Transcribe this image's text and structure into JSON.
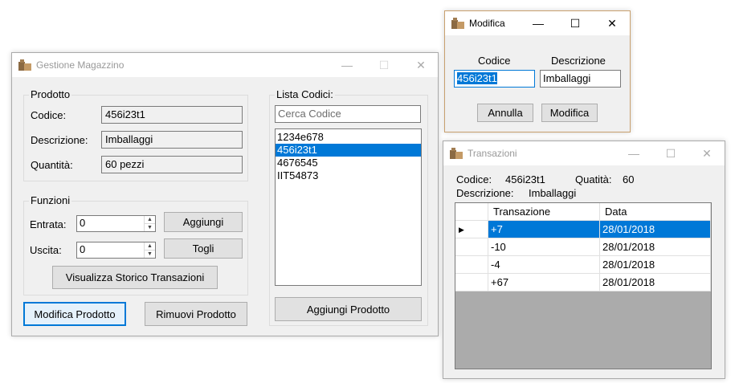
{
  "main_window": {
    "title": "Gestione Magazzino",
    "controls": {
      "minimize": "—",
      "maximize": "☐",
      "close": "✕"
    },
    "prodotto": {
      "title": "Prodotto",
      "codice_label": "Codice:",
      "codice_value": "456i23t1",
      "descrizione_label": "Descrizione:",
      "descrizione_value": "Imballaggi",
      "quantita_label": "Quantità:",
      "quantita_value": "60 pezzi"
    },
    "funzioni": {
      "title": "Funzioni",
      "entrata_label": "Entrata:",
      "entrata_value": "0",
      "uscita_label": "Uscita:",
      "uscita_value": "0",
      "aggiungi_label": "Aggiungi",
      "togli_label": "Togli",
      "storico_label": "Visualizza Storico Transazioni"
    },
    "lista_codici": {
      "title": "Lista Codici:",
      "search_placeholder": "Cerca Codice",
      "items": [
        "1234e678",
        "456i23t1",
        "4676545",
        "IIT54873"
      ],
      "selected_index": 1,
      "aggiungi_prodotto_label": "Aggiungi Prodotto"
    },
    "modifica_prodotto_label": "Modifica Prodotto",
    "rimuovi_prodotto_label": "Rimuovi Prodotto"
  },
  "modifica_window": {
    "title": "Modifica",
    "controls": {
      "minimize": "—",
      "maximize": "☐",
      "close": "✕"
    },
    "codice_header": "Codice",
    "descrizione_header": "Descrizione",
    "codice_value": "456i23t1",
    "descrizione_value": "Imballaggi",
    "annulla_label": "Annulla",
    "modifica_label": "Modifica"
  },
  "transazioni_window": {
    "title": "Transazioni",
    "controls": {
      "minimize": "—",
      "maximize": "☐",
      "close": "✕"
    },
    "codice_label": "Codice:",
    "codice_value": "456i23t1",
    "quantita_label": "Quatità:",
    "quantita_value": "60",
    "descrizione_label": "Descrizione:",
    "descrizione_value": "Imballaggi",
    "columns": [
      "Transazione",
      "Data"
    ],
    "rows": [
      {
        "transazione": "+7",
        "data": "28/01/2018"
      },
      {
        "transazione": "-10",
        "data": "28/01/2018"
      },
      {
        "transazione": "-4",
        "data": "28/01/2018"
      },
      {
        "transazione": "+67",
        "data": "28/01/2018"
      }
    ],
    "selected_row": 0,
    "row_indicator": "▶"
  },
  "colors": {
    "selection": "#0078d7",
    "window_bg": "#f0f0f0",
    "grid_empty": "#ababab",
    "active_border": "#c8a06e"
  }
}
